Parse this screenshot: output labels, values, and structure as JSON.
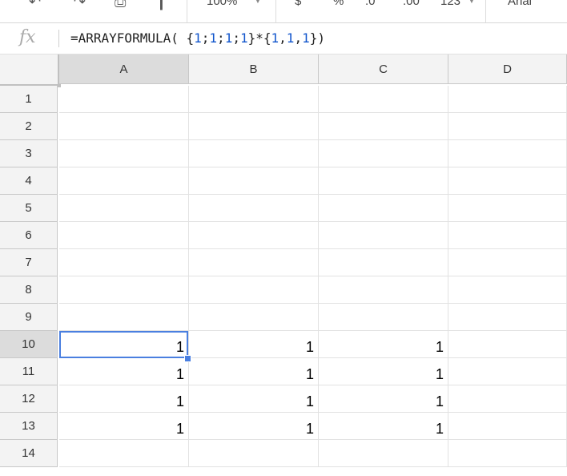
{
  "toolbar": {
    "zoom": "100%",
    "currency_symbol": "$",
    "percent_symbol": "%",
    "decrease_decimal": ".0",
    "increase_decimal": ".00",
    "more_formats": "123",
    "font_name": "Arial"
  },
  "formula_bar": {
    "fx_label": "fx",
    "formula": {
      "prefix": "=ARRAYFORMULA( {",
      "n1": "1",
      "s1": ";",
      "n2": "1",
      "s2": ";",
      "n3": "1",
      "s3": ";",
      "n4": "1",
      "mid": "}*{",
      "m1": "1",
      "c1": ",",
      "m2": "1",
      "c2": ",",
      "m3": "1",
      "suffix": "})"
    }
  },
  "grid": {
    "columns": [
      "A",
      "B",
      "C",
      "D"
    ],
    "rows": [
      "1",
      "2",
      "3",
      "4",
      "5",
      "6",
      "7",
      "8",
      "9",
      "10",
      "11",
      "12",
      "13",
      "14"
    ],
    "cells": [
      [
        "",
        "",
        "",
        ""
      ],
      [
        "",
        "",
        "",
        ""
      ],
      [
        "",
        "",
        "",
        ""
      ],
      [
        "",
        "",
        "",
        ""
      ],
      [
        "",
        "",
        "",
        ""
      ],
      [
        "",
        "",
        "",
        ""
      ],
      [
        "",
        "",
        "",
        ""
      ],
      [
        "",
        "",
        "",
        ""
      ],
      [
        "",
        "",
        "",
        ""
      ],
      [
        "1",
        "1",
        "1",
        ""
      ],
      [
        "1",
        "1",
        "1",
        ""
      ],
      [
        "1",
        "1",
        "1",
        ""
      ],
      [
        "1",
        "1",
        "1",
        ""
      ],
      [
        "",
        "",
        "",
        ""
      ]
    ],
    "selected_cell": "A10"
  }
}
